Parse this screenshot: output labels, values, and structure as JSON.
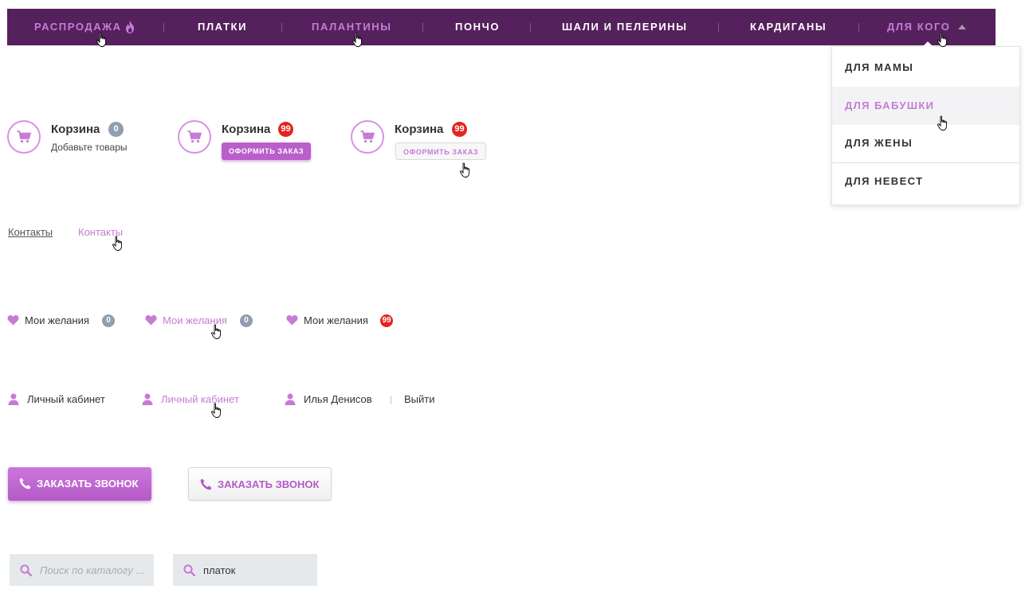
{
  "nav": {
    "items": [
      {
        "label": "РАСПРОДАЖА",
        "accent": true
      },
      {
        "label": "ПЛАТКИ",
        "accent": false
      },
      {
        "label": "ПАЛАНТИНЫ",
        "accent": true
      },
      {
        "label": "ПОНЧО",
        "accent": false
      },
      {
        "label": "ШАЛИ И ПЕЛЕРИНЫ",
        "accent": false
      },
      {
        "label": "КАРДИГАНЫ",
        "accent": false
      },
      {
        "label": "ДЛЯ КОГО",
        "accent": true
      }
    ]
  },
  "dropdown": {
    "items": [
      {
        "label": "ДЛЯ МАМЫ"
      },
      {
        "label": "ДЛЯ БАБУШКИ"
      },
      {
        "label": "ДЛЯ ЖЕНЫ"
      },
      {
        "label": "ДЛЯ НЕВЕСТ"
      }
    ]
  },
  "carts": [
    {
      "title": "Корзина",
      "count": "0",
      "subtitle": "Добавьте товары"
    },
    {
      "title": "Корзина",
      "count": "99",
      "button": "ОФОРМИТЬ ЗАКАЗ"
    },
    {
      "title": "Корзина",
      "count": "99",
      "button": "ОФОРМИТЬ ЗАКАЗ"
    }
  ],
  "links": [
    "Контакты",
    "Контакты"
  ],
  "wishlist": [
    {
      "label": "Мои желания",
      "count": "0"
    },
    {
      "label": "Мои желания",
      "count": "0"
    },
    {
      "label": "Мои желания",
      "count": "99"
    }
  ],
  "account": {
    "login_label": "Личный кабинет",
    "login_label_hover": "Личный кабинет",
    "user_name": "Илья Денисов",
    "logout": "Выйти"
  },
  "call": {
    "label": "ЗАКАЗАТЬ ЗВОНОК",
    "label_outline": "ЗАКАЗАТЬ ЗВОНОК"
  },
  "search": {
    "placeholder": "Поиск по каталогу ...",
    "value": "платок"
  },
  "colors": {
    "nav_bg": "#55215c",
    "accent": "#c67bd6",
    "badge_grey": "#8f9eb0",
    "badge_red": "#e5241f",
    "search_bg": "#e6e9ec"
  },
  "icons": [
    "flame-icon",
    "caret-up-icon",
    "cart-icon",
    "heart-icon",
    "user-icon",
    "phone-icon",
    "search-icon",
    "hand-cursor-icon"
  ]
}
